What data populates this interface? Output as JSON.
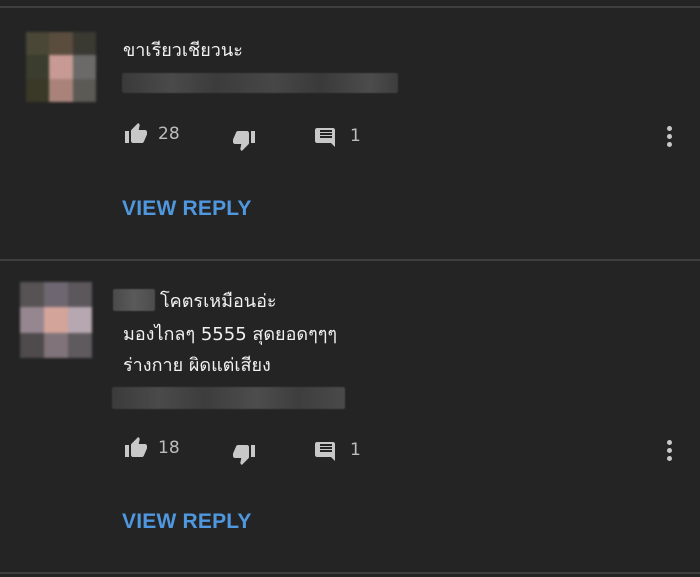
{
  "colors": {
    "background": "#242424",
    "divider": "#3f3f3f",
    "text": "#f1f1f1",
    "count": "#bdbdbd",
    "reply_link": "#4f98e0"
  },
  "comments": [
    {
      "avatar": "blurred-avatar",
      "text_lines": [
        "ขาเรียวเชียวนะ"
      ],
      "likes": "28",
      "replies": "1",
      "reply_label": "VIEW REPLY"
    },
    {
      "avatar": "blurred-avatar",
      "author_prefix": "blurred-name",
      "text_lines": [
        "โคตรเหมือนอ่ะ",
        "มองไกลๆ 5555 สุดยอดๆๆๆ",
        "ร่างกาย ผิดแต่เสียง"
      ],
      "likes": "18",
      "replies": "1",
      "reply_label": "VIEW REPLY"
    }
  ],
  "icons": {
    "like": "thumbs-up-icon",
    "dislike": "thumbs-down-icon",
    "reply": "comment-icon",
    "menu": "more-vertical-icon"
  }
}
